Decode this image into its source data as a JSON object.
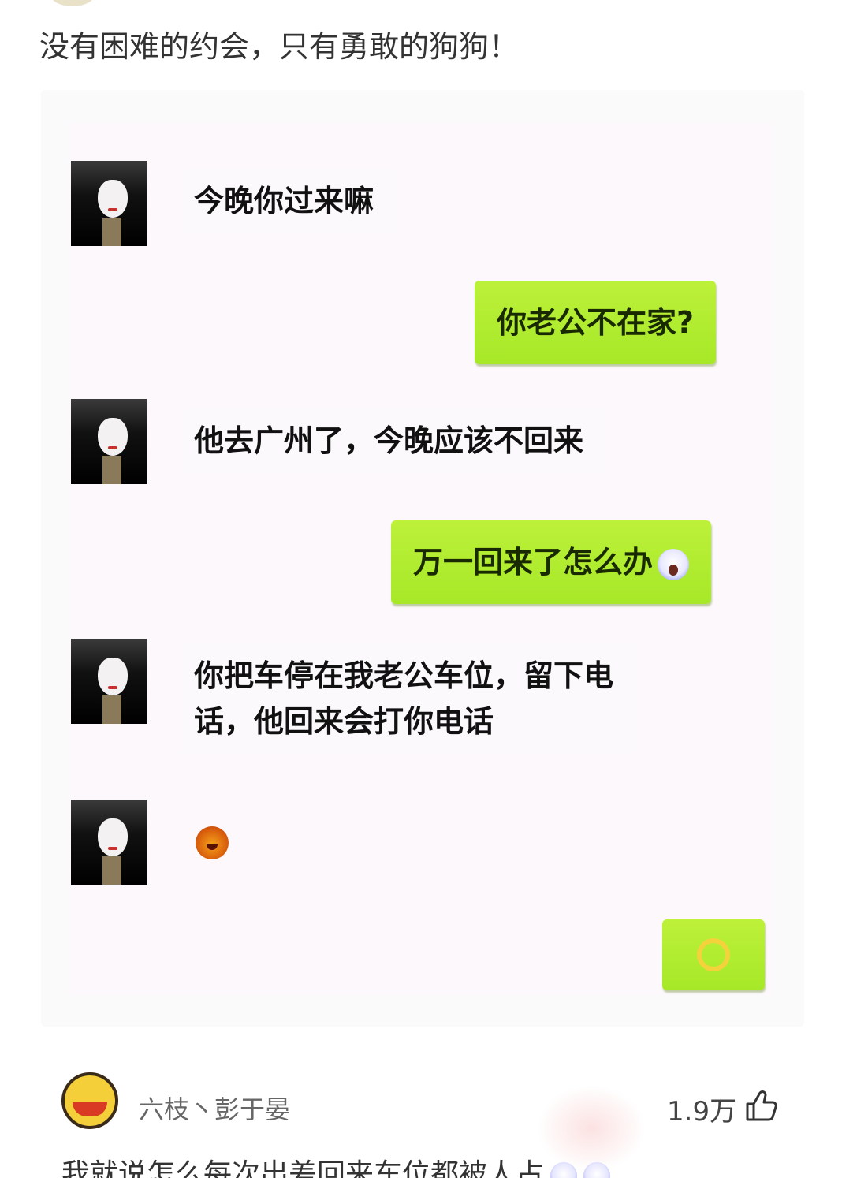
{
  "post": {
    "text": "没有困难的约会，只有勇敢的狗狗！"
  },
  "chat": {
    "messages": [
      {
        "side": "in",
        "text": "今晚你过来嘛"
      },
      {
        "side": "out",
        "text": "你老公不在家?"
      },
      {
        "side": "in",
        "text": "他去广州了，今晚应该不回来"
      },
      {
        "side": "out",
        "text": "万一回来了怎么办",
        "emoji": "scared-face-icon"
      },
      {
        "side": "in",
        "text_line1": "你把车停在我老公车位，留下电",
        "text_line2": "话，他回来会打你电话"
      },
      {
        "side": "in",
        "emoji": "angry-face-icon"
      },
      {
        "side": "out",
        "emoji": "ok-hand-icon"
      }
    ]
  },
  "comment": {
    "author": "六枝丶彭于晏",
    "likes": "1.9万",
    "text": "我就说怎么每次出差回来车位都被人占"
  },
  "colors": {
    "bubble_out": "#b3ee30",
    "chat_bg": "#fcf8fb"
  }
}
